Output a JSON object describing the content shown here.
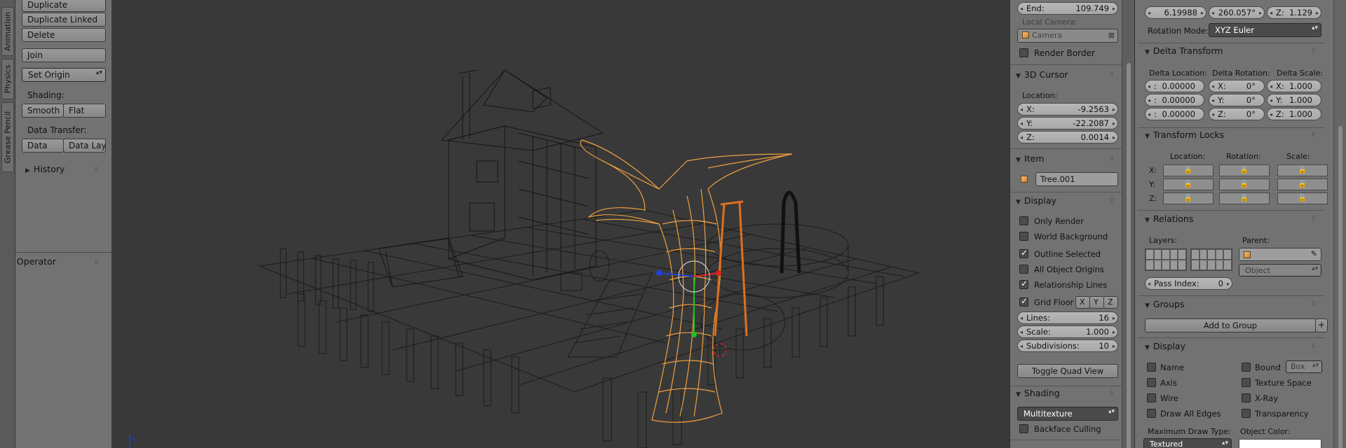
{
  "tabs": [
    {
      "label": "Animation"
    },
    {
      "label": "Physics"
    },
    {
      "label": "Grease Pencil"
    }
  ],
  "tools": {
    "duplicate": "Duplicate",
    "duplicate_linked": "Duplicate Linked",
    "delete": "Delete",
    "join": "Join",
    "set_origin": "Set Origin",
    "shading_label": "Shading:",
    "smooth": "Smooth",
    "flat": "Flat",
    "data_transfer_label": "Data Transfer:",
    "data": "Data",
    "data_lay": "Data Lay",
    "history": "History",
    "operator": "Operator"
  },
  "npanel": {
    "end_label": "End:",
    "end_value": "109.749",
    "local_camera_label": "Local Camera:",
    "camera_placeholder": "Camera",
    "render_border": "Render Border",
    "cursor_header": "3D Cursor",
    "location_label": "Location:",
    "cursor": [
      {
        "k": "X:",
        "v": "-9.2563"
      },
      {
        "k": "Y:",
        "v": "-22.2087"
      },
      {
        "k": "Z:",
        "v": "0.0014"
      }
    ],
    "item_header": "Item",
    "item_name": "Tree.001",
    "display_header": "Display",
    "display_checks": [
      {
        "label": "Only Render",
        "checked": false
      },
      {
        "label": "World Background",
        "checked": false
      },
      {
        "label": "Outline Selected",
        "checked": true
      },
      {
        "label": "All Object Origins",
        "checked": false
      },
      {
        "label": "Relationship Lines",
        "checked": true
      }
    ],
    "grid_floor": "Grid Floor",
    "axes": [
      "X",
      "Y",
      "Z"
    ],
    "grid": [
      {
        "k": "Lines:",
        "v": "16"
      },
      {
        "k": "Scale:",
        "v": "1.000"
      },
      {
        "k": "Subdivisions:",
        "v": "10"
      }
    ],
    "toggle_quad": "Toggle Quad View",
    "shading_header": "Shading",
    "shading_mode": "Multitexture",
    "backface": "Backface Culling"
  },
  "props": {
    "top_row": [
      {
        "v": "6.19988"
      },
      {
        "v": "260.057°"
      },
      {
        "k": "Z:",
        "v": "1.129"
      }
    ],
    "rotation_mode_label": "Rotation Mode:",
    "rotation_mode": "XYZ Euler",
    "delta_header": "Delta Transform",
    "delta_loc_label": "Delta Location:",
    "delta_rot_label": "Delta Rotation:",
    "delta_scale_label": "Delta Scale:",
    "delta_loc": [
      {
        "v": "0.00000"
      },
      {
        "v": "0.00000"
      },
      {
        "v": "0.00000"
      }
    ],
    "delta_rot": [
      {
        "k": "X:",
        "v": "0°"
      },
      {
        "k": "Y:",
        "v": "0°"
      },
      {
        "k": "Z:",
        "v": "0°"
      }
    ],
    "delta_scale": [
      {
        "k": "X:",
        "v": "1.000"
      },
      {
        "k": "Y:",
        "v": "1.000"
      },
      {
        "k": "Z:",
        "v": "1.000"
      }
    ],
    "locks_header": "Transform Locks",
    "lock_cols": [
      "Location:",
      "Rotation:",
      "Scale:"
    ],
    "lock_rows": [
      "X:",
      "Y:",
      "Z:"
    ],
    "relations_header": "Relations",
    "layers_label": "Layers:",
    "parent_label": "Parent:",
    "object_placeholder": "Object",
    "pass_index_label": "Pass Index:",
    "pass_index": "0",
    "groups_header": "Groups",
    "add_to_group": "Add to Group",
    "display_header": "Display",
    "display_left": [
      "Name",
      "Axis",
      "Wire",
      "Draw All Edges"
    ],
    "display_right": [
      "Bound",
      "Texture Space",
      "X-Ray",
      "Transparency"
    ],
    "bound_type": "Box",
    "max_draw_label": "Maximum Draw Type:",
    "max_draw_value": "Textured",
    "object_color_label": "Object Color:"
  }
}
